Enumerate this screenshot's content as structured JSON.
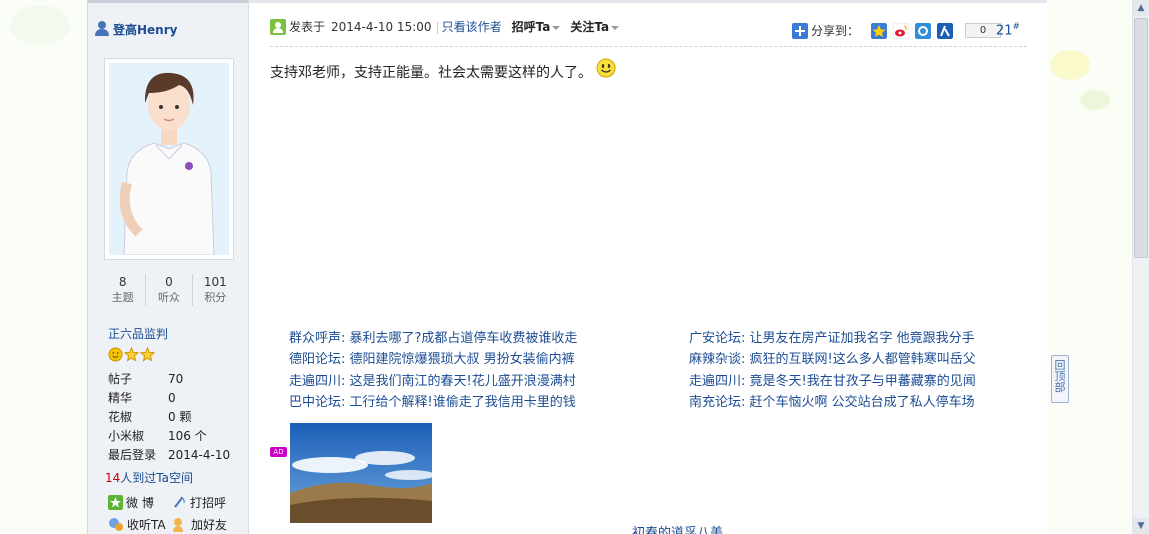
{
  "sidebar": {
    "username": "登高Henry",
    "stats": [
      {
        "value": "8",
        "label": "主题"
      },
      {
        "value": "0",
        "label": "听众"
      },
      {
        "value": "101",
        "label": "积分"
      }
    ],
    "rank": "正六品监判",
    "info": [
      {
        "key": "帖子",
        "value": "70"
      },
      {
        "key": "精华",
        "value": "0"
      },
      {
        "key": "花椒",
        "value": "0 颗"
      },
      {
        "key": "小米椒",
        "value": "106 个"
      },
      {
        "key": "最后登录",
        "value": "2014-4-10"
      }
    ],
    "visit_count": "14",
    "visit_text": "人到过Ta空间",
    "actions": {
      "weibo": "微 博",
      "greet": "打招呼",
      "follow": "收听TA",
      "friend": "加好友"
    }
  },
  "post": {
    "posted_label": "发表于",
    "datetime": "2014-4-10 15:00",
    "only_author": "只看该作者",
    "greet_menu": "招呼Ta",
    "follow_menu": "关注Ta",
    "share_label": "分享到：",
    "share_count": "0",
    "floor": "21",
    "floor_mark": "#",
    "content": "支持邓老师，支持正能量。社会太需要这样的人了。"
  },
  "links": {
    "left": [
      "群众呼声: 暴利去哪了?成都占道停车收费被谁收走",
      "德阳论坛: 德阳建院惊爆猥琐大叔 男扮女装偷内裤",
      "走遍四川: 这是我们南江的春天!花儿盛开浪漫满村",
      "巴中论坛: 工行给个解释!谁偷走了我信用卡里的钱"
    ],
    "right": [
      "广安论坛: 让男友在房产证加我名字 他竟跟我分手",
      "麻辣杂谈: 疯狂的互联网!这么多人都管韩寒叫岳父",
      "走遍四川: 竟是冬天!我在甘孜子与甲蕃藏寨的见闻",
      "南充论坛: 赶个车恼火啊 公交站台成了私人停车场"
    ]
  },
  "ad": {
    "badge": "AD",
    "caption": "初春的道孚八美"
  },
  "back_to_top": "回顶部",
  "colors": {
    "link": "#1c4d94",
    "sidebar_bg": "#eef1f6"
  }
}
